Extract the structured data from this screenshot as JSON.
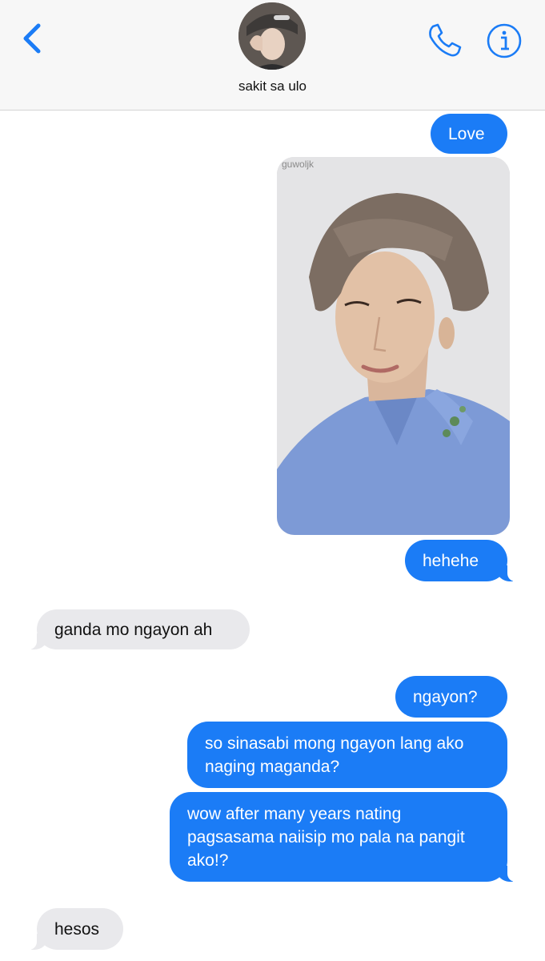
{
  "header": {
    "contact_name": "sakit sa ulo",
    "back_icon": "chevron-left-icon",
    "call_icon": "phone-icon",
    "info_icon": "info-icon"
  },
  "colors": {
    "sent_bubble": "#1b7cf6",
    "received_bubble": "#e9e9ec",
    "accent": "#1b7cf6"
  },
  "messages": [
    {
      "from": "me",
      "text": "Love"
    },
    {
      "from": "me",
      "type": "photo",
      "watermark": "guwoljk"
    },
    {
      "from": "me",
      "text": "hehehe"
    },
    {
      "from": "them",
      "text": "ganda mo ngayon ah"
    },
    {
      "from": "me",
      "text": "ngayon?"
    },
    {
      "from": "me",
      "text": "so sinasabi mong ngayon lang ako naging maganda?"
    },
    {
      "from": "me",
      "text": "wow after many years nating pagsasama naiisip mo pala na pangit ako!?"
    },
    {
      "from": "them",
      "text": "hesos"
    }
  ]
}
